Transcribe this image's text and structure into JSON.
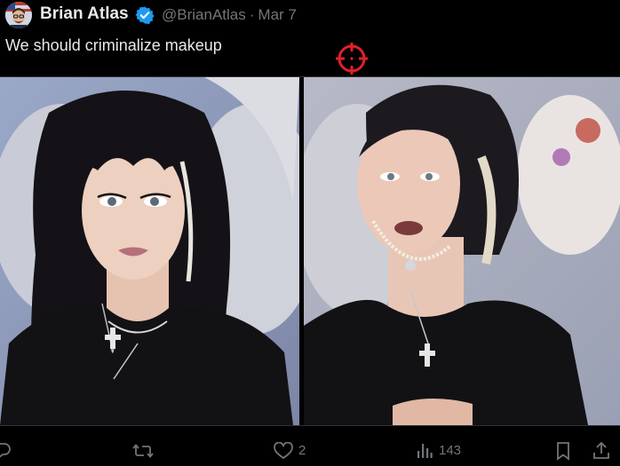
{
  "tweet": {
    "author_name": "Brian Atlas",
    "verified": true,
    "handle": "@BrianAtlas",
    "separator": "·",
    "date": "Mar 7",
    "text": "We should criminalize makeup"
  },
  "media": {
    "images": [
      {
        "description_icon": "photo-with-makeup"
      },
      {
        "description_icon": "photo-without-makeup"
      }
    ]
  },
  "actions": {
    "reply_icon": "reply-icon",
    "retweet_icon": "retweet-icon",
    "like_icon": "heart-icon",
    "like_count": "2",
    "views_icon": "views-icon",
    "views_count": "143",
    "bookmark_icon": "bookmark-icon",
    "share_icon": "share-icon"
  },
  "colors": {
    "background": "#000000",
    "text_primary": "#e7e9ea",
    "text_secondary": "#71767b",
    "verified_blue": "#1d9bf0",
    "crosshair_red": "#e0202a"
  }
}
